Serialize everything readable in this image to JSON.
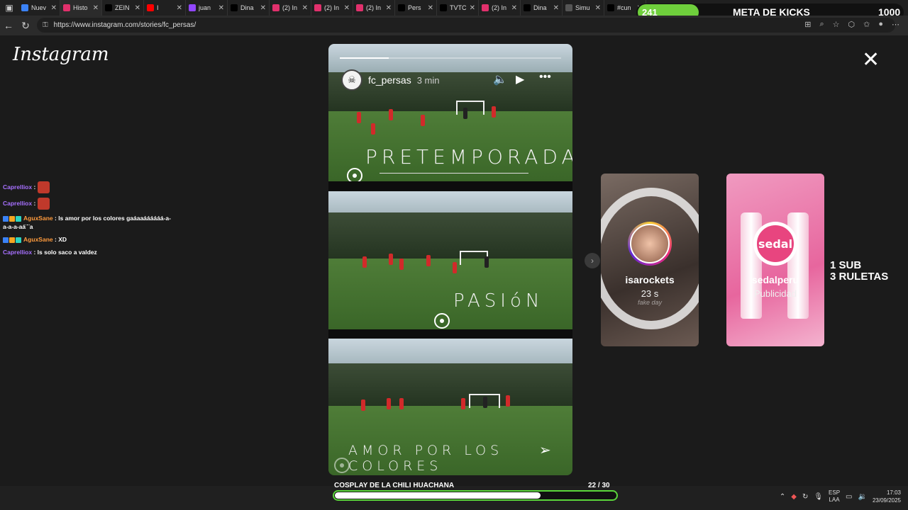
{
  "browser": {
    "tabs": [
      {
        "label": "Nuev",
        "color": "#3b82f6",
        "active": false
      },
      {
        "label": "Histo",
        "color": "#e1306c",
        "active": true
      },
      {
        "label": "ZEIN",
        "color": "#000000",
        "active": false
      },
      {
        "label": "I",
        "color": "#ff0000",
        "active": false
      },
      {
        "label": "juan",
        "color": "#9146ff",
        "active": false
      },
      {
        "label": "Dina",
        "color": "#000000",
        "active": false
      },
      {
        "label": "(2) In",
        "color": "#e1306c",
        "active": false
      },
      {
        "label": "(2) In",
        "color": "#e1306c",
        "active": false
      },
      {
        "label": "(2) In",
        "color": "#e1306c",
        "active": false
      },
      {
        "label": "Pers",
        "color": "#000000",
        "active": false
      },
      {
        "label": "TVTC",
        "color": "#000000",
        "active": false
      },
      {
        "label": "(2) In",
        "color": "#e1306c",
        "active": false
      },
      {
        "label": "Dina",
        "color": "#000000",
        "active": false
      },
      {
        "label": "Simu",
        "color": "#555555",
        "active": false
      },
      {
        "label": "#cun",
        "color": "#000000",
        "active": false
      }
    ],
    "url": "https://www.instagram.com/stories/fc_persas/"
  },
  "meta_overlay": {
    "current": "241",
    "title": "META DE KICKS",
    "goal": "1000",
    "progress": 0.241,
    "color": "#6fcf3c"
  },
  "instagram": {
    "logo": "Instagram",
    "story": {
      "username": "fc_persas",
      "time": "3 min",
      "progress": 0.22,
      "texts": [
        "PRETEMPORADA",
        "PASIóN",
        "AMOR POR LOS COLORES"
      ]
    },
    "next_stories": [
      {
        "name": "isarockets",
        "sub": "23 s",
        "caption": "fake day"
      },
      {
        "name": "sedalperu",
        "sub": "Publicidad",
        "logo_text": "sedal"
      }
    ]
  },
  "chat": [
    {
      "user": "Caprelliox",
      "color": "#a770ff",
      "text": "",
      "emote": true,
      "badges": false
    },
    {
      "user": "Caprelliox",
      "color": "#a770ff",
      "text": "",
      "emote": true,
      "badges": false
    },
    {
      "user": "AguxSane",
      "color": "#ff9b3d",
      "text": "ls amor por los colores gaáaaáááááá-a-a-a-a-aá¨¨a",
      "emote": false,
      "badges": true
    },
    {
      "user": "AguxSane",
      "color": "#ff9b3d",
      "text": "XD",
      "emote": false,
      "badges": true
    },
    {
      "user": "Caprelliox",
      "color": "#a770ff",
      "text": "ls solo saco a valdez",
      "emote": false,
      "badges": false
    }
  ],
  "promo": {
    "line1": "1 SUB",
    "line2": "3 RULETAS"
  },
  "cosplay": {
    "label": "COSPLAY DE LA CHILI HUACHANA",
    "count": "22",
    "total": "/ 30",
    "progress": 0.733
  },
  "taskbar": {
    "lang1": "ESP",
    "lang2": "LAA",
    "time": "17:03",
    "date": "23/09/2025"
  }
}
